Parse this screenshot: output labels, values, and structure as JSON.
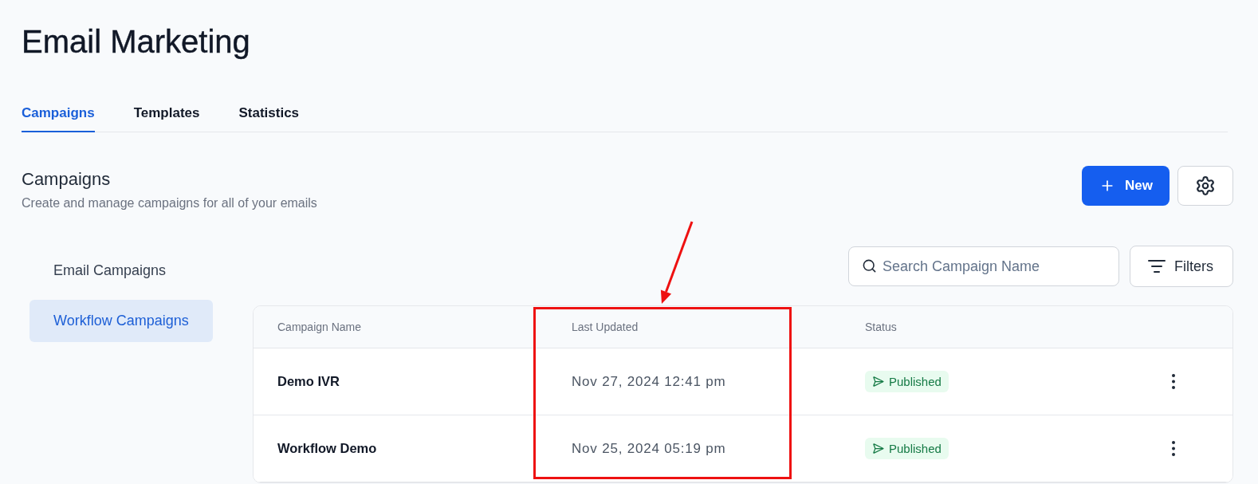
{
  "page": {
    "title": "Email Marketing"
  },
  "tabs": [
    {
      "label": "Campaigns",
      "selected": true
    },
    {
      "label": "Templates",
      "selected": false
    },
    {
      "label": "Statistics",
      "selected": false
    }
  ],
  "section": {
    "title": "Campaigns",
    "subtitle": "Create and manage campaigns for all of your emails",
    "new_button": "New"
  },
  "sidebar": {
    "items": [
      {
        "label": "Email Campaigns",
        "selected": false
      },
      {
        "label": "Workflow Campaigns",
        "selected": true
      }
    ]
  },
  "toolbar": {
    "search": {
      "placeholder": "Search Campaign Name"
    },
    "filters_button": "Filters"
  },
  "table": {
    "columns": [
      "Campaign Name",
      "Last Updated",
      "Status"
    ],
    "rows": [
      {
        "name": "Demo IVR",
        "last_updated": "Nov 27, 2024 12:41 pm",
        "status": "Published"
      },
      {
        "name": "Workflow Demo",
        "last_updated": "Nov 25, 2024 05:19 pm",
        "status": "Published"
      }
    ]
  },
  "callout": {
    "arrow": true,
    "frame": true
  }
}
